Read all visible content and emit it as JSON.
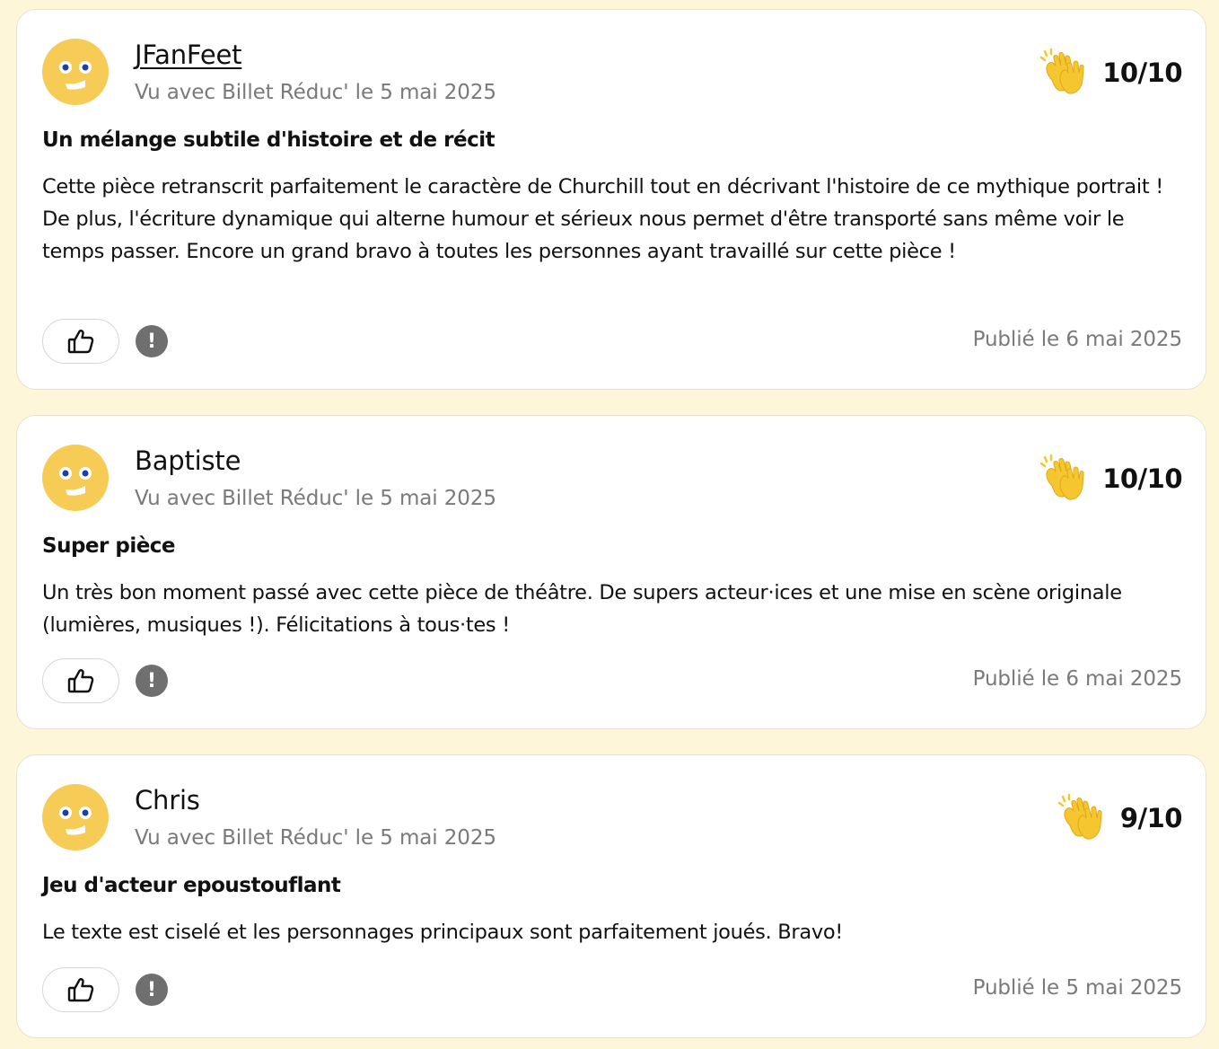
{
  "colors": {
    "page_background": "#fdf6d9",
    "card_background": "#ffffff",
    "avatar_yellow": "#f6cc56",
    "avatar_eyes": "#1f3fa8",
    "clap_yellow": "#f5c630",
    "muted_text": "#7a7a7a",
    "report_grey": "#6f6f6f"
  },
  "reviews": [
    {
      "author": "JFanFeet",
      "author_is_link": true,
      "seen_with": "Vu avec Billet Réduc' le 5 mai 2025",
      "rating": "10/10",
      "rating_icon": "clapping-hands-icon",
      "title": "Un mélange subtile d'histoire et de récit",
      "body": "Cette pièce retranscrit parfaitement le caractère de Churchill tout en décrivant l'histoire de ce mythique portrait ! De plus, l'écriture dynamique qui alterne humour et sérieux nous permet d'être transporté sans même voir le temps passer. Encore un grand bravo à toutes les personnes ayant travaillé sur cette pièce !",
      "like_icon": "thumbs-up-icon",
      "report_label": "!",
      "published": "Publié le 6 mai 2025"
    },
    {
      "author": "Baptiste",
      "author_is_link": false,
      "seen_with": "Vu avec Billet Réduc' le 5 mai 2025",
      "rating": "10/10",
      "rating_icon": "clapping-hands-icon",
      "title": "Super pièce",
      "body": "Un très bon moment passé avec cette pièce de théâtre. De supers acteur·ices et une mise en scène originale (lumières, musiques !). Félicitations à tous·tes !",
      "like_icon": "thumbs-up-icon",
      "report_label": "!",
      "published": "Publié le 6 mai 2025"
    },
    {
      "author": "Chris",
      "author_is_link": false,
      "seen_with": "Vu avec Billet Réduc' le 5 mai 2025",
      "rating": "9/10",
      "rating_icon": "clapping-hands-icon",
      "title": "Jeu d'acteur epoustouflant",
      "body": "Le texte est ciselé et les personnages principaux sont parfaitement joués. Bravo!",
      "like_icon": "thumbs-up-icon",
      "report_label": "!",
      "published": "Publié le 5 mai 2025"
    }
  ]
}
